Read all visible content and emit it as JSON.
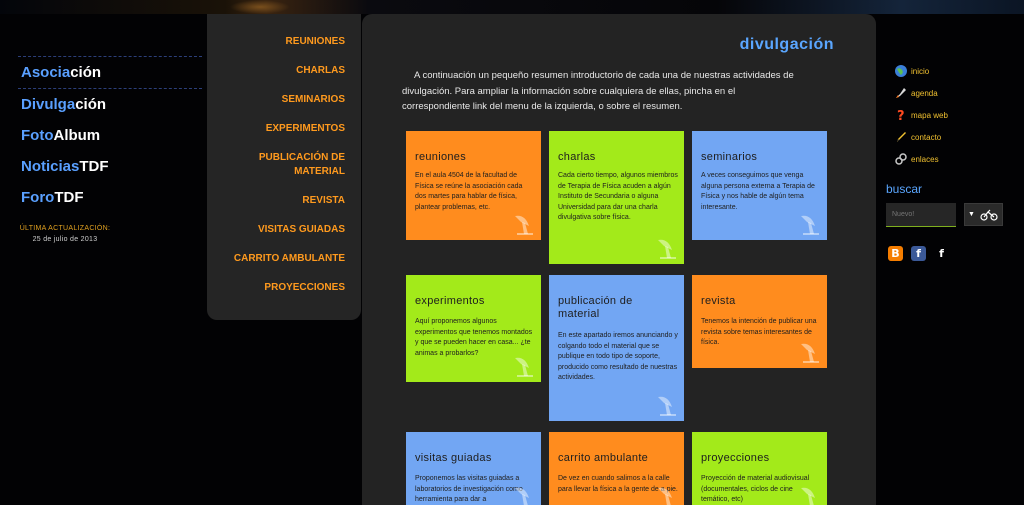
{
  "site_nav": {
    "links": [
      {
        "part_a": "Asocia",
        "part_b": "ción"
      },
      {
        "part_a": "Divulga",
        "part_b": "ción"
      },
      {
        "part_a": "Foto",
        "part_b": "Album"
      },
      {
        "part_a": "Noticias",
        "part_b": "TDF"
      },
      {
        "part_a": "Foro",
        "part_b": "TDF"
      }
    ],
    "updated_label": "ÚLTIMA ACTUALIZACIÓN:",
    "updated_date": "25 de julio de 2013"
  },
  "sub_menu": {
    "items": [
      "REUNIONES",
      "CHARLAS",
      "SEMINARIOS",
      "EXPERIMENTOS",
      "PUBLICACIÓN DE MATERIAL",
      "REVISTA",
      "VISITAS GUIADAS",
      "CARRITO AMBULANTE",
      "PROYECCIONES"
    ]
  },
  "main": {
    "title": "divulgación",
    "intro": "A continuación un pequeño resumen introductorio de cada una de nuestras actividades de divulgación. Para ampliar la información sobre cualquiera de ellas, pincha en el correspondiente link del menu de la izquierda, o sobre el resumen.",
    "cards": [
      {
        "title": "reuniones",
        "desc": "En el aula 4504 de la facultad de Física se reúne la asociación cada dos martes para hablar de física, plantear problemas, etc.",
        "color": "#ff8c1e"
      },
      {
        "title": "charlas",
        "desc": "Cada cierto tiempo, algunos miembros de Terapia de Física acuden a algún Instituto de Secundaria o alguna Universidad para dar una charla divulgativa sobre física.",
        "color": "#a3ea1a"
      },
      {
        "title": "seminarios",
        "desc": "A veces conseguimos que venga alguna persona externa a Terapia de Física y nos hable de algún tema interesante.",
        "color": "#72a6f3"
      },
      {
        "title": "experimentos",
        "desc": "Aquí proponemos algunos experimentos que tenemos montados y que se pueden hacer en casa... ¿te animas a probarlos?",
        "color": "#a3ea1a"
      },
      {
        "title": "publicación de material",
        "desc": "En este apartado iremos anunciando y colgando todo el material que se publique en todo tipo de soporte, producido como resultado de nuestras actividades.",
        "color": "#72a6f3"
      },
      {
        "title": "revista",
        "desc": "Tenemos la intención de publicar una revista sobre temas interesantes de física.",
        "color": "#ff8c1e"
      },
      {
        "title": "visitas guiadas",
        "desc": "Proponemos las visitas guiadas a laboratorios de investigación como herramienta para dar a",
        "color": "#72a6f3"
      },
      {
        "title": "carrito ambulante",
        "desc": "De vez en cuando salimos a la calle para llevar la física a la gente de a pie.",
        "color": "#ff8c1e"
      },
      {
        "title": "proyecciones",
        "desc": "Proyección de material audiovisual (documentales, ciclos de cine temático, etc)",
        "color": "#a3ea1a"
      }
    ]
  },
  "right_nav": {
    "links": [
      {
        "label": "inicio",
        "icon": "globe-icon"
      },
      {
        "label": "agenda",
        "icon": "rocket-icon"
      },
      {
        "label": "mapa web",
        "icon": "question-icon"
      },
      {
        "label": "contacto",
        "icon": "pencil-icon"
      },
      {
        "label": "enlaces",
        "icon": "link-icon"
      }
    ]
  },
  "search": {
    "label": "buscar",
    "placeholder": "Nuevo!",
    "button_arrow": "▼"
  },
  "social": {
    "blogger": "B",
    "facebook": "f",
    "facebook_alt": "f"
  }
}
